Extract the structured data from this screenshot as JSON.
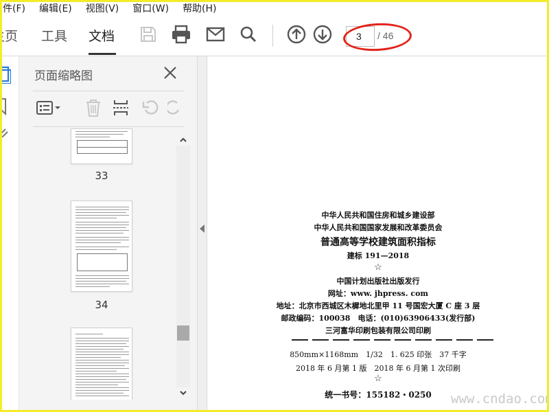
{
  "menu": [
    "件(F)",
    "编辑(E)",
    "视图(V)",
    "窗口(W)",
    "帮助(H)"
  ],
  "tabs": {
    "home": "主页",
    "tools": "工具",
    "document": "文档"
  },
  "page_nav": {
    "current": "3",
    "total": "/ 46"
  },
  "panel": {
    "title": "页面缩略图"
  },
  "thumbnails": [
    {
      "page": "33"
    },
    {
      "page": "34"
    }
  ],
  "document": {
    "line1": "中华人民共和国住房和城乡建设部",
    "line2": "中华人民共和国国家发展和改革委员会",
    "title": "普通高等学校建筑面积指标",
    "code": "建标 191—2018",
    "star": "☆",
    "publisher": "中国计划出版社出版发行",
    "website": "网址：www. jhpress. com",
    "address": "地址：北京市西城区木樨地北里甲 11 号国宏大厦 C 座 3 层",
    "postal": "邮政编码：100038　电话：(010)63906433(发行部)",
    "printer": "三河富华印刷包装有限公司印刷",
    "format": "850mm×1168mm　1/32　1. 625 印张　37 千字",
    "edition": "2018 年 6 月第 1 版　2018 年 6 月第 1 次印刷",
    "star2": "☆",
    "isbn": "统一书号：155182・0250"
  },
  "watermark": "www.cndao.com",
  "colors": {
    "annotation": "#e2231a",
    "frame": "#f2ec2a"
  },
  "icons": [
    "save-icon",
    "print-icon",
    "email-icon",
    "search-icon",
    "page-up-icon",
    "page-down-icon",
    "options-icon",
    "delete-icon",
    "insert-page-icon",
    "undo-icon",
    "redo-icon",
    "close-icon",
    "bookmark-icon",
    "attachment-icon"
  ]
}
